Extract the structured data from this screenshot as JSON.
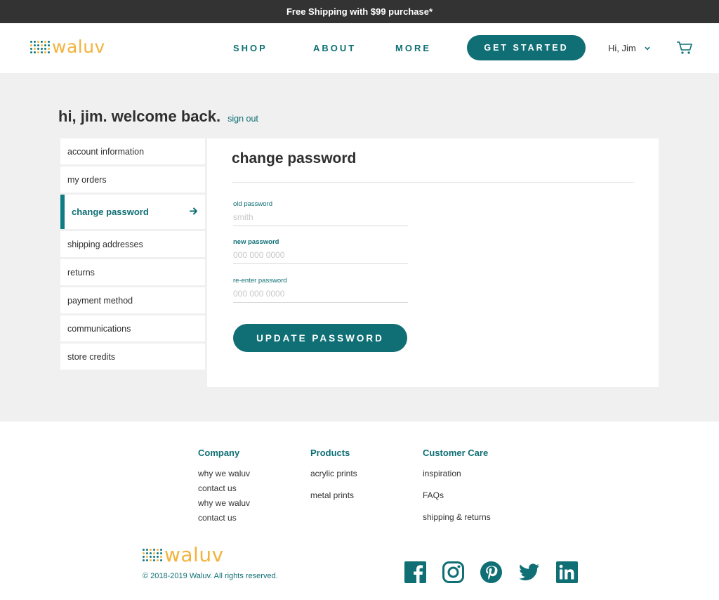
{
  "promo": {
    "text": "Free Shipping with $99 purchase*"
  },
  "header": {
    "logo_text": "waluv",
    "nav": {
      "shop": "SHOP",
      "about": "ABOUT",
      "more": "MORE"
    },
    "cta": "GET STARTED",
    "user_greeting": "Hi, Jim",
    "icons": {
      "dropdown": "chevron-down-icon",
      "cart": "cart-icon"
    }
  },
  "welcome": {
    "title": "hi, jim. welcome back.",
    "sign_out": "sign out"
  },
  "sidebar": {
    "items": [
      {
        "label": "account information"
      },
      {
        "label": "my orders"
      },
      {
        "label": "change password",
        "active": true
      },
      {
        "label": "shipping addresses"
      },
      {
        "label": "returns"
      },
      {
        "label": "payment method"
      },
      {
        "label": "communications"
      },
      {
        "label": "store credits"
      }
    ]
  },
  "form": {
    "title": "change password",
    "old_password": {
      "label": "old password",
      "placeholder": "smith"
    },
    "new_password": {
      "label": "new password",
      "placeholder": "000 000 0000"
    },
    "reenter_password": {
      "label": "re-enter password",
      "placeholder": "000 000 0000"
    },
    "submit": "UPDATE PASSWORD"
  },
  "footer": {
    "company": {
      "heading": "Company",
      "links": [
        "why we waluv",
        "contact us",
        "why we waluv",
        "contact us"
      ]
    },
    "products": {
      "heading": "Products",
      "links": [
        "acrylic prints",
        "metal prints"
      ]
    },
    "customer_care": {
      "heading": "Customer Care",
      "links": [
        "inspiration",
        "FAQs",
        "shipping & returns"
      ]
    },
    "logo_text": "waluv",
    "copyright": "© 2018-2019 Waluv. All rights reserved.",
    "social_icons": [
      "facebook-icon",
      "instagram-icon",
      "pinterest-icon",
      "twitter-icon",
      "linkedin-icon"
    ]
  },
  "colors": {
    "brand_teal": "#0f6f75",
    "brand_gold": "#f2b33d",
    "promo_bar": "#333333",
    "background": "#f0f0f0"
  }
}
